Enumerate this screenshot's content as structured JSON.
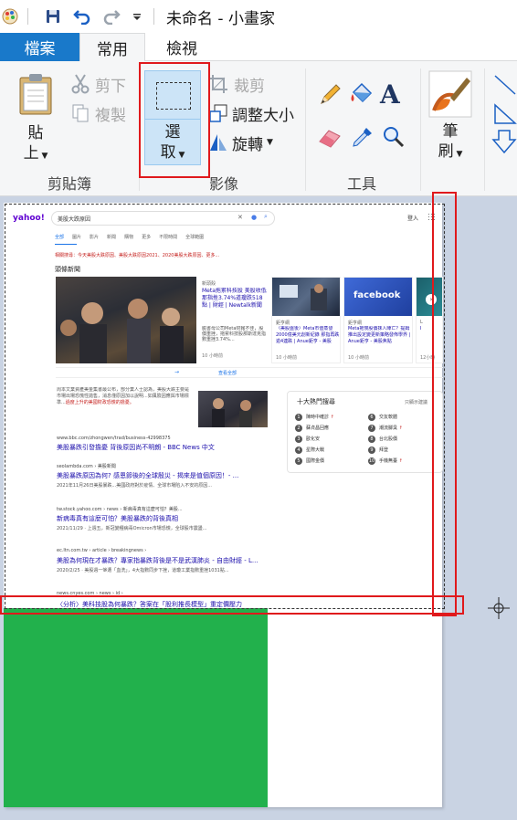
{
  "window": {
    "title": "未命名 - 小畫家"
  },
  "tabs": {
    "file": "檔案",
    "home": "常用",
    "view": "檢視"
  },
  "clipboard": {
    "paste_l1": "貼",
    "paste_l2": "上",
    "cut": "剪下",
    "copy": "複製",
    "group": "剪貼簿"
  },
  "image": {
    "select_l1": "選",
    "select_l2": "取",
    "crop": "裁剪",
    "resize": "調整大小",
    "rotate": "旋轉",
    "group": "影像"
  },
  "tools": {
    "group": "工具"
  },
  "brushes": {
    "l1": "筆",
    "l2": "刷"
  },
  "search": {
    "logo": "yahoo!",
    "query": "美股大跌原因",
    "login": "登入",
    "nav": [
      "全部",
      "圖片",
      "影片",
      "新聞",
      "購物",
      "更多",
      "不限時間",
      "全球範圍"
    ],
    "related": "相關搜尋：今天美股大跌原因、美股大跌原因2021、2020美股大跌原因、更多...",
    "top_news": "頭條新聞",
    "news": [
      {
        "source": "新頭殼",
        "title": "Meta拖累科技股 美股收低那指挫3.74%道瓊跌518點 | 財經 | Newtalk新聞",
        "desc": "臉書母公司Meta財報不佳，股價重挫，拖累科技股那斯達克指數重挫3.74%...",
        "time": "10 小時前"
      },
      {
        "source": "鉅亨網",
        "title": "〈美股盤後〉Meta市值蒸發2000億美元創新紀錄 那指再跌逾4連跌 | Anue鉅亨 - 美股",
        "time": "10 小時前"
      },
      {
        "source": "鉅亨網",
        "title": "Meta拖慢股價抹人陣亡？提姆推出設定變更新策略發佈學界 | Anue鉅亨 - 美股焦點",
        "time": "10 小時前"
      },
      {
        "source": "L",
        "title": "I",
        "time": "12小時"
      }
    ],
    "more_news": "查看全部",
    "result0": {
      "snippet": "周本文業資產美金集書最公布，部分業人士認為，美股大跌主要是市場出場恐慌性拋售，消息僅原因加以說明...如風險因應與市場標準...",
      "snippet_red": "過度上升的美國財政恐慌的擔憂。",
      "url": "www.bbc.com/zhongwen/trad/business-42998375",
      "title": "美股暴跌引發擔憂 背後原因尚不明朗 - BBC News 中文"
    },
    "result1": {
      "url": "seolambda.com › 美股新聞",
      "title": "美股暴跌原因為何? 感恩節後的全球殷災 - 揭來是值個原因！- ...",
      "snippet": "2021年11月26日美股暴跌...美國政府對於疫情、全球市場陷入不安的原因..."
    },
    "result2": {
      "url": "tw.stock.yahoo.com › news › 新病毒真有這麼可怕？美股...",
      "title": "新病毒真有這麼可怕？美股暴跌的背後真相",
      "snippet": "2021/11/29 · 上週五，新冠變種病毒Omicron市場恐慌，全球股市震盪..."
    },
    "result3": {
      "url": "ec.ltn.com.tw › article › breakingnews ›",
      "title": "美股為何現在才暴跌？專家指暴跌背後是不是武漢肺炎 - 自由財經 - L...",
      "snippet": "2020/2/25 · 美股週一慘遭「血洗」，4大指數同步下挫，道瓊工業指數重挫1031點..."
    },
    "result4": {
      "url": "news.cnyes.com › news › id ›",
      "title": "〈分析〉美科技股為何暴跌？答案在「股利推長模型」重定價壓力"
    },
    "hot_title": "十大熱門搜尋",
    "hot_more": "只顯示建議",
    "hot": [
      "陳時中確診",
      "蘇貞昌回應",
      "歐化安",
      "星際大戰",
      "國際金價",
      "交友軟體",
      "潮流腳臭",
      "台北股價",
      "拜登",
      "手機無臺"
    ]
  }
}
